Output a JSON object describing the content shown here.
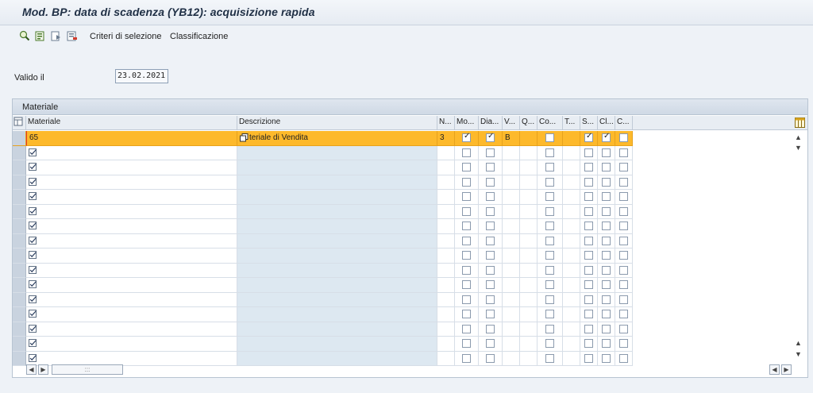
{
  "window": {
    "title": "Mod. BP: data di scadenza (YB12): acquisizione rapida"
  },
  "toolbar": {
    "icons": [
      "find-icon",
      "details-icon",
      "next-icon",
      "delete-icon"
    ],
    "criteri_label": "Criteri di selezione",
    "classificazione_label": "Classificazione"
  },
  "validity": {
    "label": "Valido il",
    "value": "23.02.2021"
  },
  "panel": {
    "title": "Materiale"
  },
  "columns": [
    {
      "key": "materiale",
      "label": "Materiale"
    },
    {
      "key": "descrizione",
      "label": "Descrizione"
    },
    {
      "key": "n",
      "label": "N..."
    },
    {
      "key": "mo",
      "label": "Mo..."
    },
    {
      "key": "dia",
      "label": "Dia..."
    },
    {
      "key": "v",
      "label": "V..."
    },
    {
      "key": "q",
      "label": "Q..."
    },
    {
      "key": "co",
      "label": "Co..."
    },
    {
      "key": "t",
      "label": "T..."
    },
    {
      "key": "s",
      "label": "S..."
    },
    {
      "key": "cl",
      "label": "Cl..."
    },
    {
      "key": "c",
      "label": "C..."
    }
  ],
  "rows": [
    {
      "materiale": "65",
      "descrizione": "teriale di Vendita",
      "n": "3",
      "mo": true,
      "dia": true,
      "v": "B",
      "co": false,
      "s": true,
      "cl": true,
      "c": false,
      "selected": true
    }
  ],
  "empty_row_count": 15,
  "colors": {
    "highlight": "#fdb92b",
    "background": "#eef2f7",
    "descrizione_bg": "#dde8f1"
  }
}
